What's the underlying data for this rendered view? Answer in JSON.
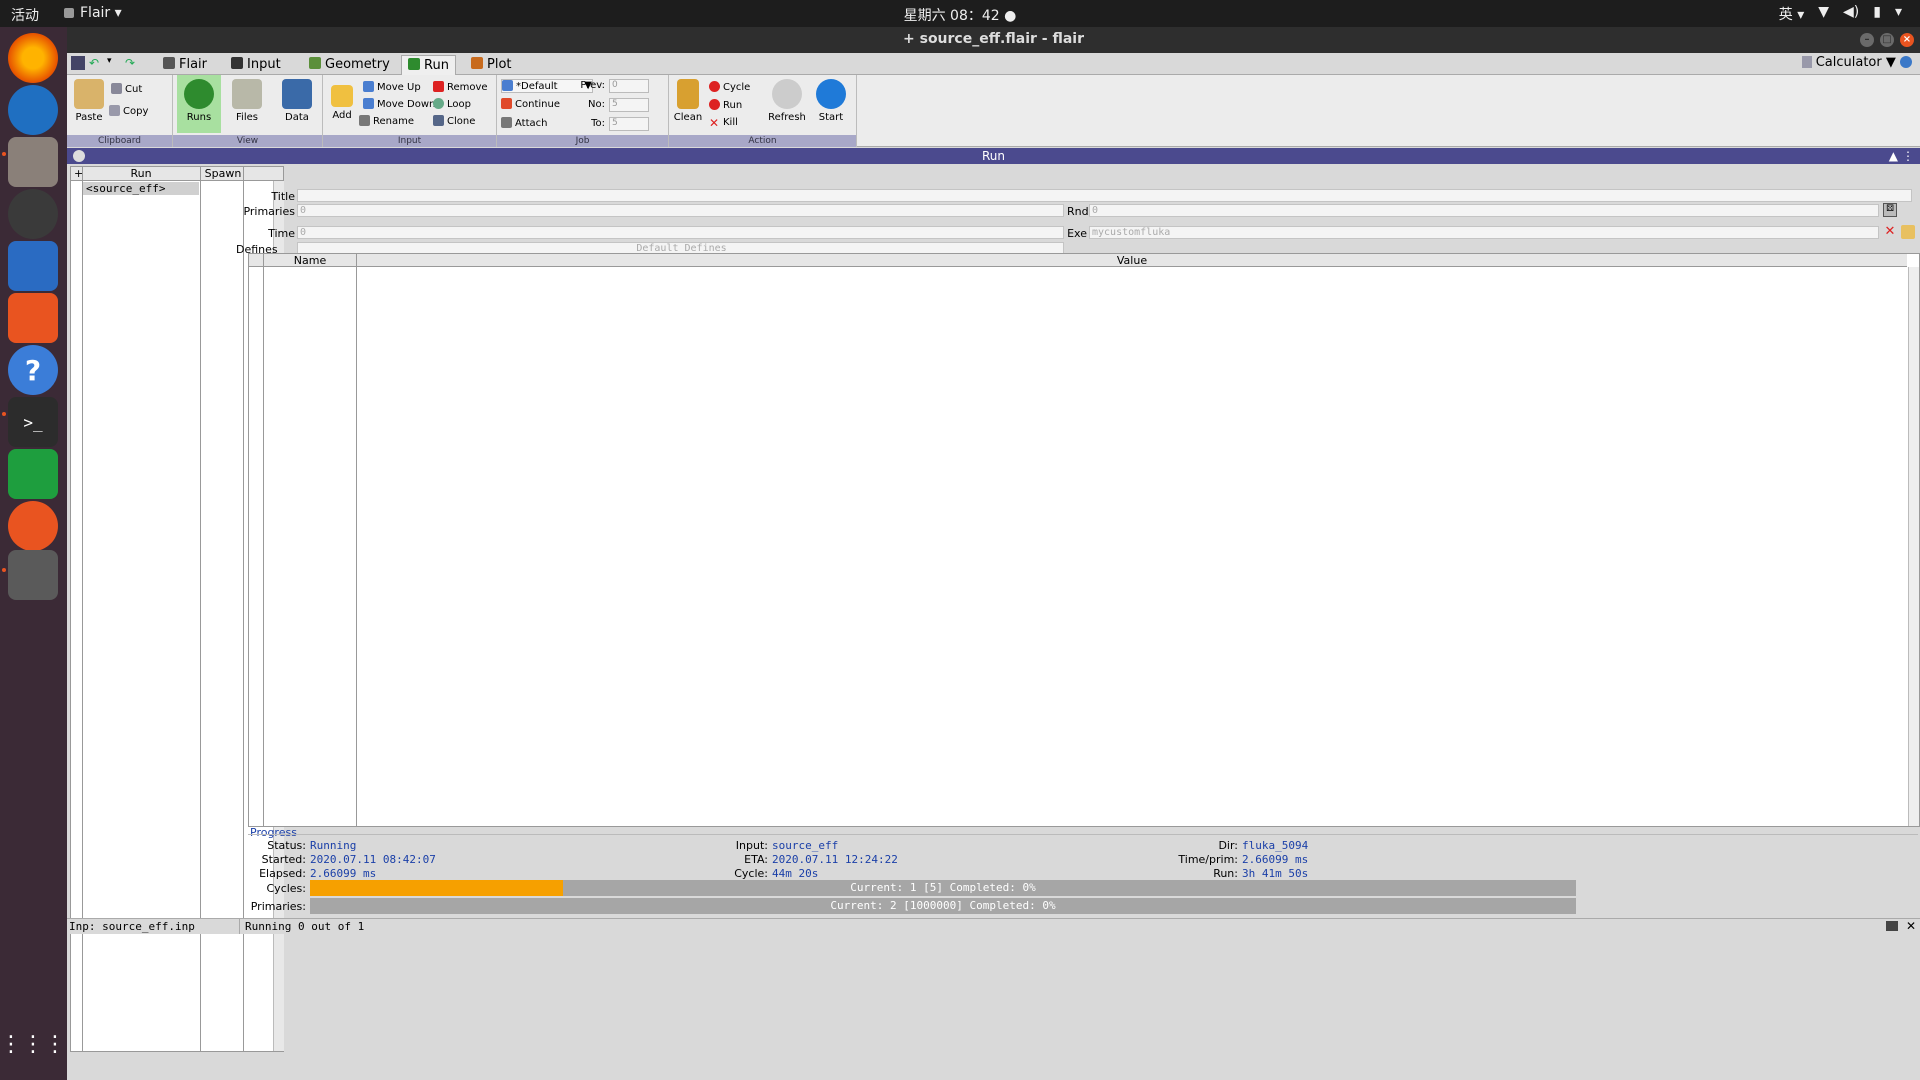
{
  "topbar": {
    "activities": "活动",
    "app_menu": "Flair",
    "clock": "星期六 08：42",
    "ime": "英"
  },
  "window": {
    "title": "+ source_eff.flair - flair"
  },
  "tabs": [
    {
      "label": "Flair",
      "icon": "flair-icon"
    },
    {
      "label": "Input",
      "icon": "input-icon"
    },
    {
      "label": "Geometry",
      "icon": "geometry-icon"
    },
    {
      "label": "Run",
      "icon": "run-icon"
    },
    {
      "label": "Plot",
      "icon": "plot-icon"
    }
  ],
  "calculator": "Calculator",
  "ribbon": {
    "clipboard": {
      "label": "Clipboard",
      "paste": "Paste",
      "cut": "Cut",
      "copy": "Copy"
    },
    "view": {
      "label": "View",
      "runs": "Runs",
      "files": "Files",
      "data": "Data"
    },
    "input": {
      "label": "Input",
      "add": "Add",
      "move_up": "Move Up",
      "move_down": "Move Down",
      "rename": "Rename",
      "remove": "Remove",
      "loop": "Loop",
      "clone": "Clone"
    },
    "job": {
      "label": "Job",
      "queue": "*Default",
      "continue": "Continue",
      "attach": "Attach",
      "prev": "Prev:",
      "no": "No:",
      "to": "To:",
      "prev_val": "0",
      "no_val": "5",
      "to_val": "5"
    },
    "action": {
      "label": "Action",
      "clean": "Clean",
      "cycle": "Cycle",
      "run": "Run",
      "kill": "Kill",
      "refresh": "Refresh",
      "start": "Start"
    }
  },
  "panel_title": "Run",
  "runlist": {
    "col_run": "Run",
    "col_spawn": "Spawn",
    "items": [
      "<source_eff>"
    ]
  },
  "form": {
    "title_label": "Title",
    "primaries_label": "Primaries",
    "primaries_val": "0",
    "rnd_label": "Rnd",
    "rnd_val": "0",
    "time_label": "Time",
    "time_val": "0",
    "exe_label": "Exe",
    "exe_val": "mycustomfluka",
    "defines_label": "Defines",
    "defines_placeholder": "Default Defines"
  },
  "table": {
    "col_name": "Name",
    "col_value": "Value"
  },
  "progress": {
    "label": "Progress",
    "status_label": "Status:",
    "status": "Running",
    "started_label": "Started:",
    "started": "2020.07.11 08:42:07",
    "elapsed_label": "Elapsed:",
    "elapsed": "2.66099 ms",
    "input_label": "Input:",
    "input": "source_eff",
    "eta_label": "ETA:",
    "eta": "2020.07.11 12:24:22",
    "cycle_label": "Cycle:",
    "cycle": "44m 20s",
    "dir_label": "Dir:",
    "dir": "fluka_5094",
    "timeprim_label": "Time/prim:",
    "timeprim": "2.66099 ms",
    "run_label": "Run:",
    "run": "3h 41m 50s",
    "cycles_label": "Cycles:",
    "cycles_text": "Current: 1 [5]  Completed: 0%",
    "cycles_fill": 0.2,
    "primaries_label": "Primaries:",
    "primaries_text": "Current: 2 [1000000]  Completed: 0%",
    "primaries_fill": 0.0
  },
  "status": {
    "left": "Inp: source_eff.inp",
    "mid": "Running 0 out of 1"
  },
  "colors": {
    "accent": "#4b4a8e",
    "progress": "#f6a000",
    "value_text": "#1a3fa8"
  }
}
